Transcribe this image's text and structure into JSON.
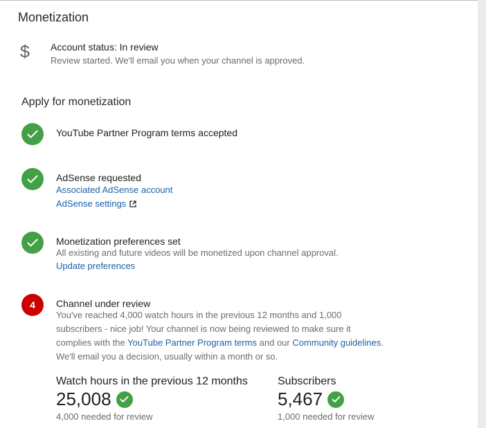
{
  "page": {
    "title": "Monetization"
  },
  "account": {
    "status": "Account status: In review",
    "subtext": "Review started. We'll email you when your channel is approved.",
    "icon": "dollar-icon"
  },
  "apply": {
    "heading": "Apply for monetization",
    "steps": [
      {
        "icon": "check-icon",
        "title": "YouTube Partner Program terms accepted"
      },
      {
        "icon": "check-icon",
        "title": "AdSense requested",
        "link1": "Associated AdSense account",
        "link2": "AdSense settings"
      },
      {
        "icon": "check-icon",
        "title": "Monetization preferences set",
        "text": "All existing and future videos will be monetized upon channel approval.",
        "link1": "Update preferences"
      },
      {
        "icon": "number-badge",
        "badge": "4",
        "title": "Channel under review",
        "text_part1": "You've reached 4,000 watch hours in the previous 12 months and 1,000 subscribers - nice job! Your channel is now being reviewed to make sure it complies with the",
        "link_terms": "YouTube Partner Program terms",
        "text_part2": "and our",
        "link_guidelines": "Community guidelines",
        "text_part3": ". We'll email you a decision, usually within a month or so."
      }
    ]
  },
  "stats": {
    "watch_hours": {
      "label": "Watch hours in the previous 12 months",
      "value": "25,008",
      "needed": "4,000 needed for review"
    },
    "subscribers": {
      "label": "Subscribers",
      "value": "5,467",
      "needed": "1,000 needed for review"
    }
  },
  "colors": {
    "success": "#43a047",
    "badge_red": "#cc0000",
    "link": "#1a61a8"
  }
}
